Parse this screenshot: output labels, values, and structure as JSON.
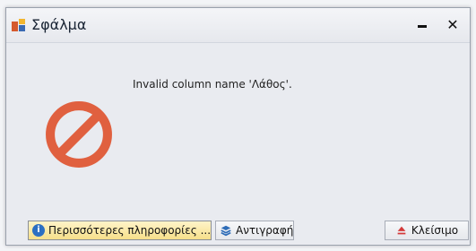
{
  "window": {
    "title": "Σφάλμα",
    "minimize_label": "—",
    "close_label": "✕",
    "icon": "app-icon"
  },
  "message": {
    "text": "Invalid column name 'Λάθος'."
  },
  "error_icon": {
    "name": "error-icon",
    "color": "#e0603f"
  },
  "buttons": {
    "more_info": {
      "label": "Περισσότερες πληροφορίες ...",
      "icon": "info-icon"
    },
    "copy": {
      "label": "Αντιγραφή",
      "icon": "stack-icon"
    },
    "close": {
      "label": "Κλείσιμο",
      "icon": "eject-icon"
    }
  }
}
